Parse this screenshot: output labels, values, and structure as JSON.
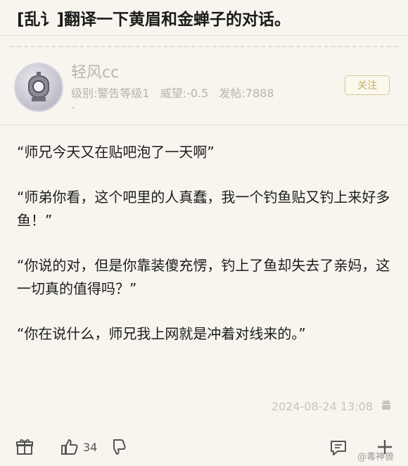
{
  "post": {
    "title": "[乱讠]翻译一下黄眉和金蝉子的对话。"
  },
  "author": {
    "username": "轻风cc",
    "level": "级别:警告等级1",
    "prestige": "威望:-0.5",
    "posts": "发帖:7888",
    "dash": "-",
    "follow_label": "关注"
  },
  "content": {
    "paragraphs": [
      "“师兄今天又在贴吧泡了一天啊”",
      "“师弟你看，这个吧里的人真蠢，我一个钓鱼贴又钓上来好多鱼！”",
      "“你说的对，但是你靠装傻充愣，钓上了鱼却失去了亲妈，这一切真的值得吗？”",
      "“你在说什么，师兄我上网就是冲着对线来的。”"
    ]
  },
  "footer": {
    "timestamp": "2024-08-24 13:08",
    "like_count": "34"
  },
  "watermark": "@毒神兽",
  "icons": {
    "avatar": "diving-helmet-avatar",
    "device": "android-icon",
    "gift": "gift-icon",
    "like": "thumbs-up-icon",
    "dislike": "thumbs-down-icon",
    "comment": "comment-icon",
    "more": "plus-icon"
  },
  "colors": {
    "background": "#f7f5ee",
    "follow_accent": "#c2ad6a"
  }
}
